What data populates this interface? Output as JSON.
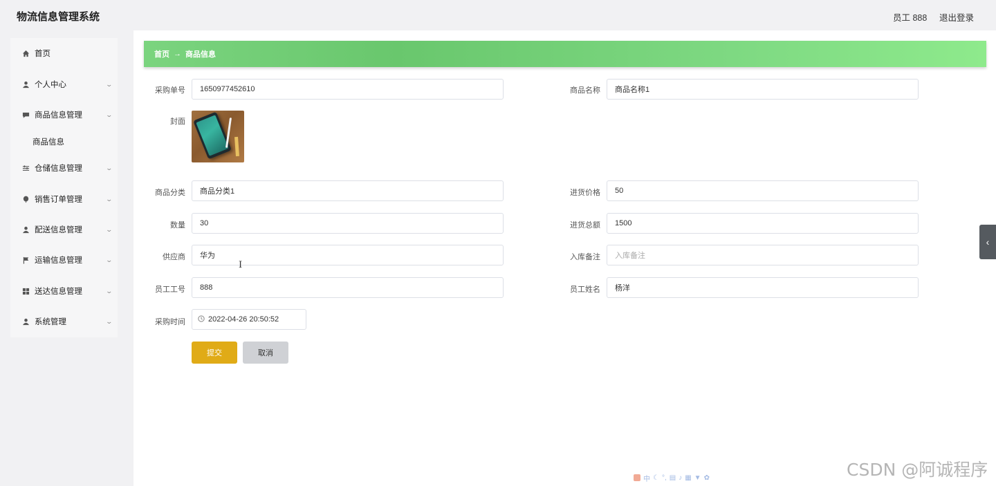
{
  "app": {
    "title": "物流信息管理系统"
  },
  "header": {
    "user": "员工 888",
    "logout": "退出登录"
  },
  "sidebar": {
    "items": [
      {
        "label": "首页",
        "icon": "home-icon",
        "has_children": false
      },
      {
        "label": "个人中心",
        "icon": "user-icon",
        "has_children": true
      },
      {
        "label": "商品信息管理",
        "icon": "chat-icon",
        "has_children": true
      },
      {
        "label": "商品信息",
        "icon": "",
        "has_children": false,
        "sub": true
      },
      {
        "label": "仓储信息管理",
        "icon": "sliders-icon",
        "has_children": true
      },
      {
        "label": "销售订单管理",
        "icon": "balloon-icon",
        "has_children": true
      },
      {
        "label": "配送信息管理",
        "icon": "user-icon",
        "has_children": true
      },
      {
        "label": "运输信息管理",
        "icon": "flag-icon",
        "has_children": true
      },
      {
        "label": "送达信息管理",
        "icon": "grid-icon",
        "has_children": true
      },
      {
        "label": "系统管理",
        "icon": "user-icon",
        "has_children": true
      }
    ]
  },
  "breadcrumb": {
    "home": "首页",
    "separator": "→",
    "current": "商品信息"
  },
  "form": {
    "purchase_no": {
      "label": "采购单号",
      "value": "1650977452610"
    },
    "product_name": {
      "label": "商品名称",
      "value": "商品名称1"
    },
    "cover": {
      "label": "封面"
    },
    "category": {
      "label": "商品分类",
      "value": "商品分类1"
    },
    "purchase_price": {
      "label": "进货价格",
      "value": "50"
    },
    "quantity": {
      "label": "数量",
      "value": "30"
    },
    "total_amount": {
      "label": "进货总额",
      "value": "1500"
    },
    "supplier": {
      "label": "供应商",
      "value": "华为"
    },
    "storage_note": {
      "label": "入库备注",
      "placeholder": "入库备注"
    },
    "employee_no": {
      "label": "员工工号",
      "value": "888"
    },
    "employee_name": {
      "label": "员工姓名",
      "value": "杨洋"
    },
    "purchase_time": {
      "label": "采购时间",
      "value": "2022-04-26 20:50:52"
    }
  },
  "buttons": {
    "submit": "提交",
    "cancel": "取消"
  },
  "watermark": "CSDN @阿诚程序",
  "ime_bar": "中",
  "colors": {
    "breadcrumb_green": "#6fcd73",
    "submit_yellow": "#e0ab17",
    "cancel_gray": "#cfd1d5"
  }
}
